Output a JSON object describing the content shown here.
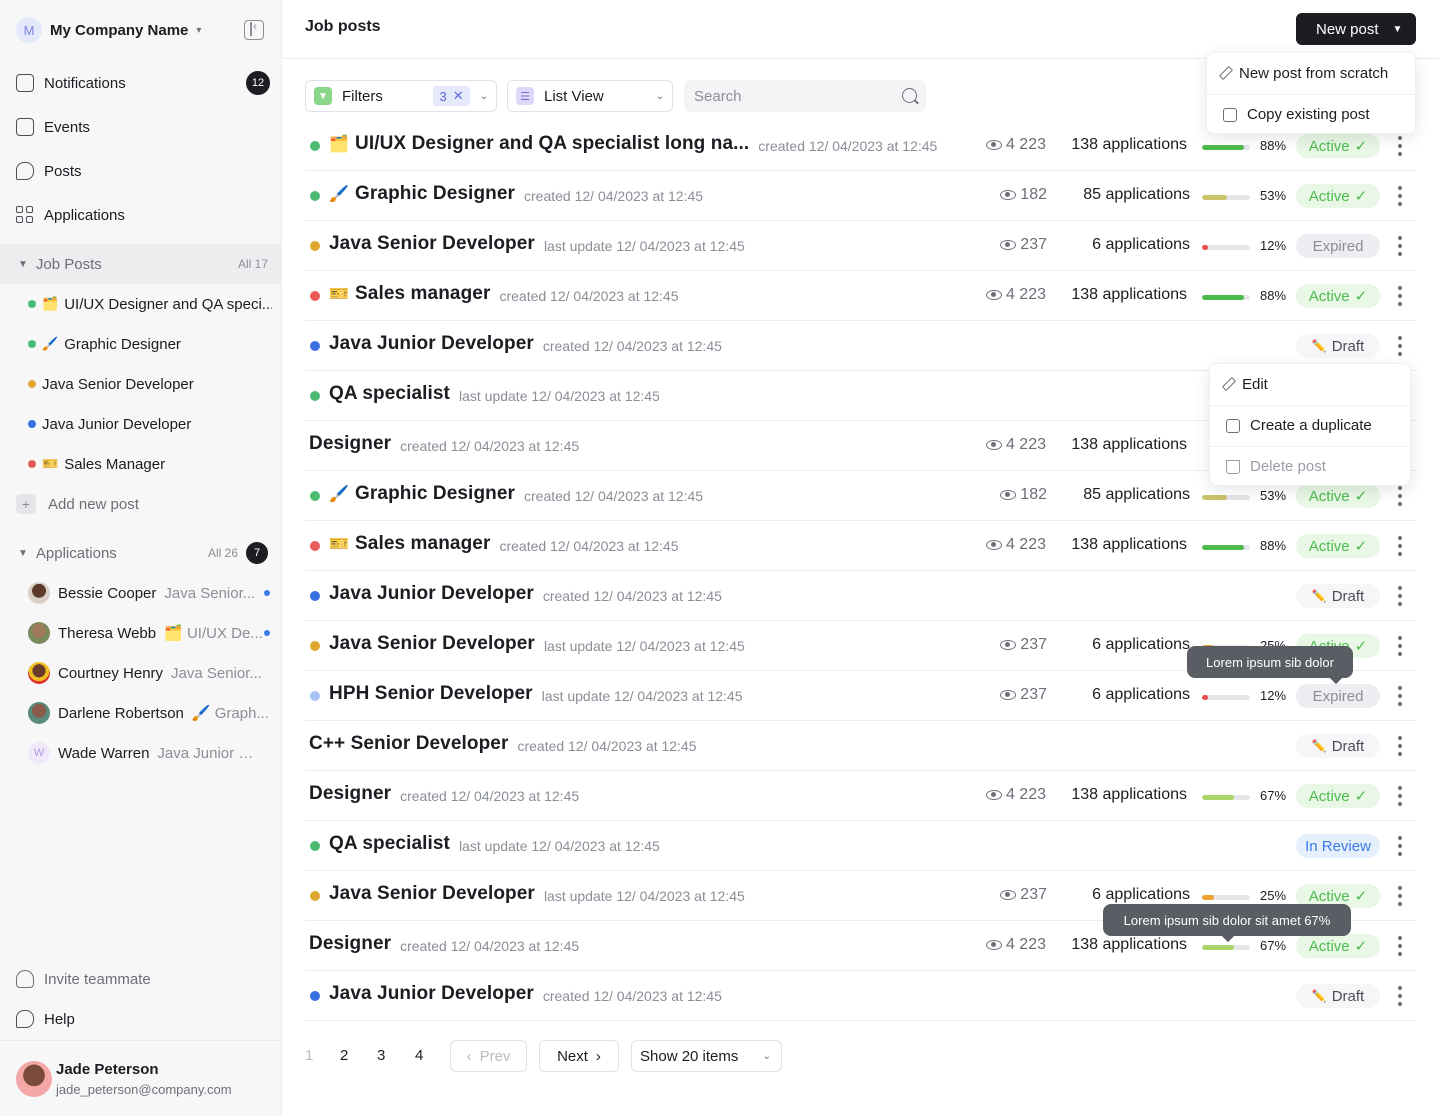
{
  "sidebar": {
    "company_initial": "M",
    "company_name": "My Company Name",
    "nav": [
      {
        "label": "Notifications",
        "badge": "12"
      },
      {
        "label": "Events"
      },
      {
        "label": "Posts"
      },
      {
        "label": "Applications"
      }
    ],
    "job_posts": {
      "label": "Job Posts",
      "count": "All 17",
      "items": [
        {
          "label": "UI/UX Designer and QA speci...",
          "color": "#4cbb72",
          "emoji": "🗂️"
        },
        {
          "label": "Graphic Designer",
          "color": "#4cbb72",
          "emoji": "🖌️"
        },
        {
          "label": "Java Senior Developer",
          "color": "#e0a730"
        },
        {
          "label": "Java Junior Developer",
          "color": "#3a6fe0"
        },
        {
          "label": "Sales Manager",
          "color": "#ea5b5b",
          "emoji": "🎫"
        }
      ],
      "add_label": "Add new post"
    },
    "applications": {
      "label": "Applications",
      "count": "All 26",
      "badge": "7",
      "items": [
        {
          "name": "Bessie Cooper",
          "role": "Java Senior...",
          "unread": true
        },
        {
          "name": "Theresa Webb",
          "role": "🗂️ UI/UX De...",
          "unread": true
        },
        {
          "name": "Courtney Henry",
          "role": "Java Senior..."
        },
        {
          "name": "Darlene Robertson",
          "role": "🖌️ Graph..."
        },
        {
          "name": "Wade Warren",
          "role": "Java Junior D...",
          "initial": "W"
        }
      ]
    },
    "invite_label": "Invite teammate",
    "help_label": "Help",
    "user": {
      "name": "Jade Peterson",
      "email": "jade_peterson@company.com"
    }
  },
  "header": {
    "title": "Job posts",
    "new_post_label": "New post"
  },
  "new_post_menu": [
    "New post from scratch",
    "Copy existing post"
  ],
  "row_menu": [
    "Edit",
    "Create a duplicate",
    "Delete post"
  ],
  "toolbar": {
    "filters_label": "Filters",
    "filters_count": "3",
    "view_label": "List View",
    "search_placeholder": "Search"
  },
  "rows": [
    {
      "title": "UI/UX Designer and QA specialist long na...",
      "emoji": "🗂️",
      "dot": "#4cbb72",
      "meta": "created 12/ 04/2023 at 12:45",
      "views": "4 223",
      "apps": "138 applications",
      "pct": "88%",
      "fill": 0.88,
      "bar": "#4cbb4c",
      "status": "Active"
    },
    {
      "title": "Graphic Designer",
      "emoji": "🖌️",
      "dot": "#4cbb72",
      "meta": "created 12/ 04/2023 at 12:45",
      "views": "182",
      "apps": "85 applications",
      "pct": "53%",
      "fill": 0.53,
      "bar": "#c9c46a",
      "status": "Active"
    },
    {
      "title": "Java Senior Developer",
      "dot": "#e0a730",
      "meta": "last update 12/ 04/2023 at 12:45",
      "views": "237",
      "apps": "6 applications",
      "pct": "12%",
      "fill": 0.12,
      "bar": "#ea4b4b",
      "status": "Expired"
    },
    {
      "title": "Sales manager",
      "emoji": "🎫",
      "dot": "#ea5b5b",
      "meta": "created 12/ 04/2023 at 12:45",
      "views": "4 223",
      "apps": "138 applications",
      "pct": "88%",
      "fill": 0.88,
      "bar": "#4cbb4c",
      "status": "Active"
    },
    {
      "title": "Java Junior Developer",
      "dot": "#3a6fe0",
      "meta": "created 12/ 04/2023 at 12:45",
      "status": "Draft"
    },
    {
      "title": "QA specialist",
      "dot": "#4cbb72",
      "meta": "last update 12/ 04/2023 at 12:45"
    },
    {
      "title": "Designer",
      "meta": "created 12/ 04/2023 at 12:45",
      "views": "4 223",
      "apps": "138 applications"
    },
    {
      "title": "Graphic Designer",
      "emoji": "🖌️",
      "dot": "#4cbb72",
      "meta": "created 12/ 04/2023 at 12:45",
      "views": "182",
      "apps": "85 applications",
      "pct": "53%",
      "fill": 0.53,
      "bar": "#c9c46a",
      "status": "Active"
    },
    {
      "title": "Sales manager",
      "emoji": "🎫",
      "dot": "#ea5b5b",
      "meta": "created 12/ 04/2023 at 12:45",
      "views": "4 223",
      "apps": "138 applications",
      "pct": "88%",
      "fill": 0.88,
      "bar": "#4cbb4c",
      "status": "Active"
    },
    {
      "title": "Java Junior Developer",
      "dot": "#3a6fe0",
      "meta": "created 12/ 04/2023 at 12:45",
      "status": "Draft"
    },
    {
      "title": "Java Senior Developer",
      "dot": "#e0a730",
      "meta": "last update 12/ 04/2023 at 12:45",
      "views": "237",
      "apps": "6 applications",
      "pct": "25%",
      "fill": 0.25,
      "bar": "#f0a030",
      "status": "Active"
    },
    {
      "title": "HPH Senior Developer",
      "dot": "#a9c3f5",
      "meta": "last update 12/ 04/2023 at 12:45",
      "views": "237",
      "apps": "6 applications",
      "pct": "12%",
      "fill": 0.12,
      "bar": "#ea4b4b",
      "status": "Expired"
    },
    {
      "title": "C++ Senior Developer",
      "meta": "created 12/ 04/2023 at 12:45",
      "status": "Draft"
    },
    {
      "title": "Designer",
      "meta": "created 12/ 04/2023 at 12:45",
      "views": "4 223",
      "apps": "138 applications",
      "pct": "67%",
      "fill": 0.67,
      "bar": "#a9d46a",
      "status": "Active"
    },
    {
      "title": "QA specialist",
      "dot": "#4cbb72",
      "meta": "last update 12/ 04/2023 at 12:45",
      "status": "In Review"
    },
    {
      "title": "Java Senior Developer",
      "dot": "#e0a730",
      "meta": "last update 12/ 04/2023 at 12:45",
      "views": "237",
      "apps": "6 applications",
      "pct": "25%",
      "fill": 0.25,
      "bar": "#f0a030",
      "status": "Active"
    },
    {
      "title": "Designer",
      "meta": "created 12/ 04/2023 at 12:45",
      "views": "4 223",
      "apps": "138 applications",
      "pct": "67%",
      "fill": 0.67,
      "bar": "#a9d46a",
      "status": "Active"
    },
    {
      "title": "Java Junior Developer",
      "dot": "#3a6fe0",
      "meta": "created 12/ 04/2023 at 12:45",
      "status": "Draft"
    }
  ],
  "tooltips": [
    "Lorem ipsum sib dolor",
    "Lorem ipsum sib dolor sit amet 67%"
  ],
  "pagination": {
    "pages": [
      "1",
      "2",
      "3",
      "4"
    ],
    "prev_label": "Prev",
    "next_label": "Next",
    "show_label": "Show 20 items"
  }
}
